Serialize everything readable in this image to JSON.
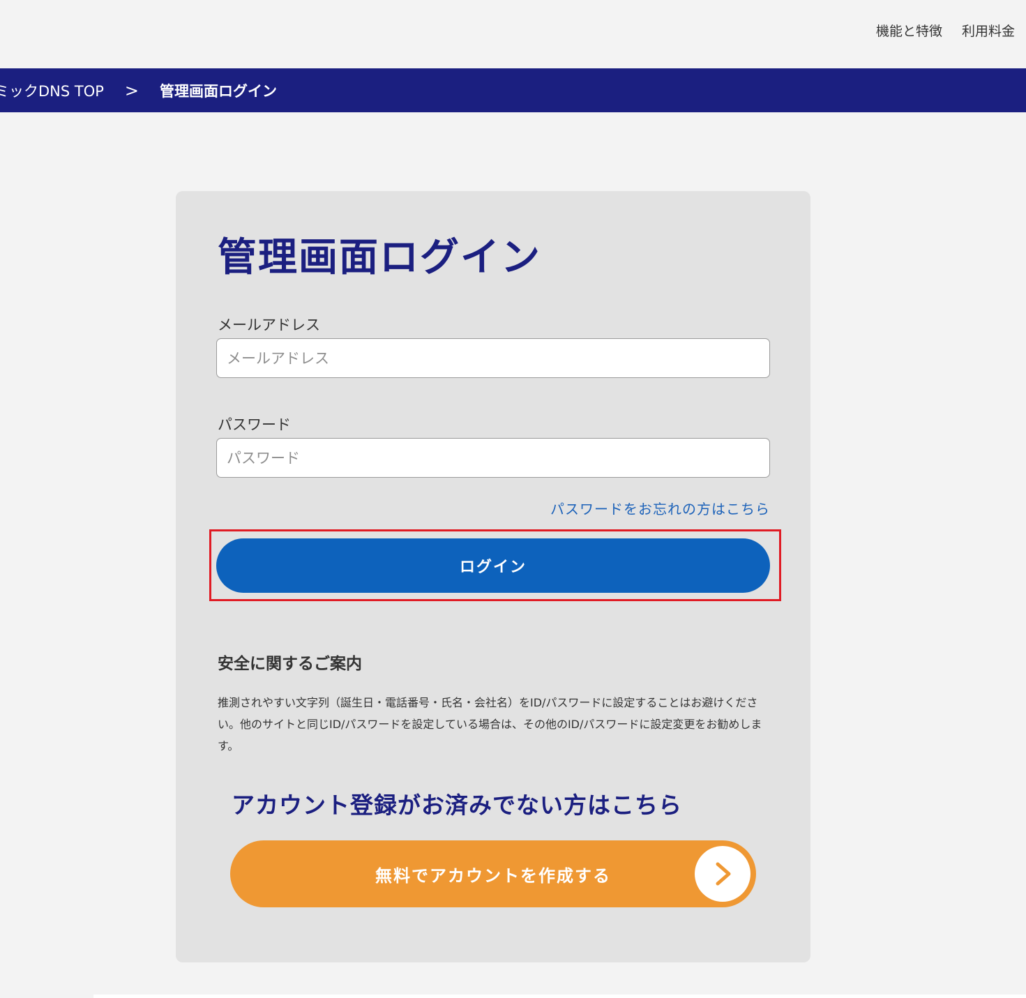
{
  "top_nav": {
    "items": [
      {
        "label": "機能と特徴"
      },
      {
        "label": "利用料金"
      }
    ]
  },
  "breadcrumb": {
    "home": "ミックDNS TOP",
    "separator": ">",
    "current": "管理画面ログイン"
  },
  "login": {
    "title": "管理画面ログイン",
    "email_label": "メールアドレス",
    "email_placeholder": "メールアドレス",
    "email_value": "",
    "password_label": "パスワード",
    "password_placeholder": "パスワード",
    "password_value": "",
    "forgot_link": "パスワードをお忘れの方はこちら",
    "login_button": "ログイン"
  },
  "safety": {
    "heading": "安全に関するご案内",
    "text": "推測されやすい文字列（誕生日・電話番号・氏名・会社名）をID/パスワードに設定することはお避けください。他のサイトと同じID/パスワードを設定している場合は、その他のID/パスワードに設定変更をお勧めします。"
  },
  "register": {
    "heading": "アカウント登録がお済みでない方はこちら",
    "button_label": "無料でアカウントを作成する",
    "arrow_icon": "chevron-right-icon"
  },
  "colors": {
    "navy": "#1b1f80",
    "button_blue": "#0d62bc",
    "link_blue": "#1c62b9",
    "orange": "#ef9833",
    "highlight_red": "#e01b24",
    "card_bg": "#e2e2e2",
    "page_bg": "#f3f3f3"
  }
}
